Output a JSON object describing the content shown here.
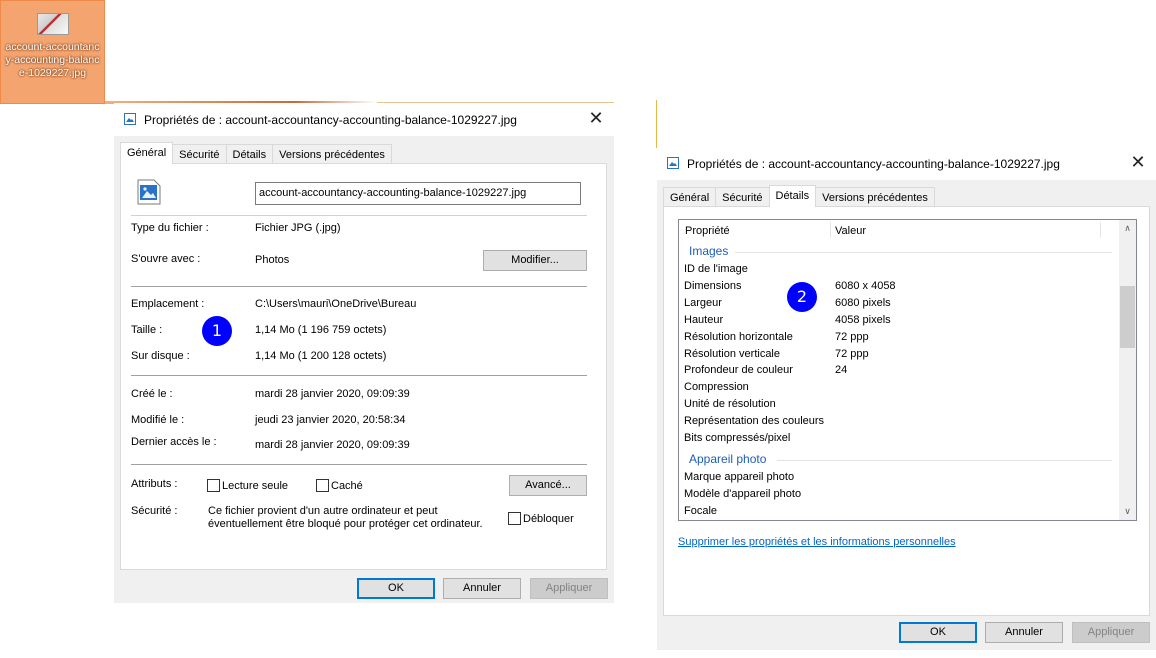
{
  "desktop_icon": {
    "label": "account-accountancy-accounting-balance-1029227.jpg"
  },
  "dialog1": {
    "title": "Propriétés de : account-accountancy-accounting-balance-1029227.jpg",
    "tabs": [
      "Général",
      "Sécurité",
      "Détails",
      "Versions précédentes"
    ],
    "filename": "account-accountancy-accounting-balance-1029227.jpg",
    "type_label": "Type du fichier :",
    "type_value": "Fichier JPG (.jpg)",
    "opens_label": "S'ouvre avec :",
    "opens_value": "Photos",
    "modify_btn": "Modifier...",
    "location_label": "Emplacement :",
    "location_value": "C:\\Users\\mauri\\OneDrive\\Bureau",
    "size_label": "Taille :",
    "size_value": "1,14 Mo (1 196 759 octets)",
    "disk_label": "Sur disque :",
    "disk_value": "1,14 Mo (1 200 128 octets)",
    "created_label": "Créé le :",
    "created_value": "mardi 28 janvier 2020, 09:09:39",
    "modified_label": "Modifié le :",
    "modified_value": "jeudi 23 janvier 2020, 20:58:34",
    "accessed_label": "Dernier accès le :",
    "accessed_value": "mardi 28 janvier 2020, 09:09:39",
    "attributes_label": "Attributs :",
    "readonly_label": "Lecture seule",
    "hidden_label": "Caché",
    "advanced_btn": "Avancé...",
    "security_label": "Sécurité :",
    "security_text_1": "Ce fichier provient d'un autre ordinateur et peut",
    "security_text_2": "éventuellement être bloqué pour protéger cet ordinateur.",
    "unblock_label": "Débloquer",
    "ok": "OK",
    "cancel": "Annuler",
    "apply": "Appliquer",
    "badge": "1"
  },
  "dialog2": {
    "title": "Propriétés de : account-accountancy-accounting-balance-1029227.jpg",
    "tabs": [
      "Général",
      "Sécurité",
      "Détails",
      "Versions précédentes"
    ],
    "col_property": "Propriété",
    "col_value": "Valeur",
    "group_images": "Images",
    "group_camera": "Appareil photo",
    "image_rows": [
      {
        "prop": "ID de l'image",
        "val": ""
      },
      {
        "prop": "Dimensions",
        "val": "6080 x 4058"
      },
      {
        "prop": "Largeur",
        "val": "6080 pixels"
      },
      {
        "prop": "Hauteur",
        "val": "4058 pixels"
      },
      {
        "prop": "Résolution horizontale",
        "val": "72 ppp"
      },
      {
        "prop": "Résolution verticale",
        "val": "72 ppp"
      },
      {
        "prop": "Profondeur de couleur",
        "val": "24"
      },
      {
        "prop": "Compression",
        "val": ""
      },
      {
        "prop": "Unité de résolution",
        "val": ""
      },
      {
        "prop": "Représentation des couleurs",
        "val": ""
      },
      {
        "prop": "Bits compressés/pixel",
        "val": ""
      }
    ],
    "camera_rows": [
      {
        "prop": "Marque appareil photo",
        "val": ""
      },
      {
        "prop": "Modèle d'appareil photo",
        "val": ""
      },
      {
        "prop": "Focale",
        "val": ""
      }
    ],
    "remove_link": "Supprimer les propriétés et les informations personnelles",
    "ok": "OK",
    "cancel": "Annuler",
    "apply": "Appliquer",
    "badge": "2"
  }
}
